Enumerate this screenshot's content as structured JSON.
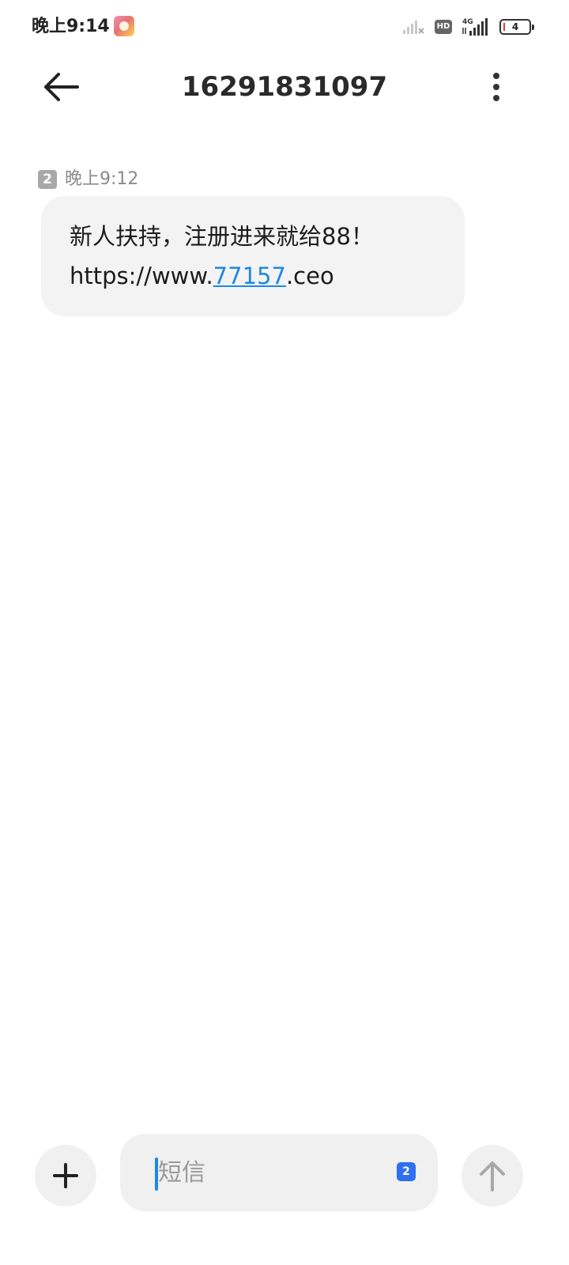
{
  "status_bar": {
    "time": "晚上9:14",
    "battery_level": "4",
    "hd_label": "HD",
    "network_label": "4G"
  },
  "header": {
    "title": "16291831097"
  },
  "thread": {
    "messages": [
      {
        "sim_slot": "2",
        "time": "晚上9:12",
        "line1": "新人扶持，注册进来就给88！",
        "line2_prefix": "https://www.",
        "line2_link": "77157",
        "line2_suffix": ".ceo"
      }
    ]
  },
  "composer": {
    "placeholder": "短信",
    "sim_slot": "2"
  },
  "colors": {
    "accent": "#1e88e5",
    "sim_badge": "#2f6ff0",
    "bubble": "#f3f3f3"
  },
  "icons": {
    "back": "arrow-left-icon",
    "more": "more-vertical-icon",
    "add": "plus-icon",
    "send": "arrow-up-icon"
  }
}
